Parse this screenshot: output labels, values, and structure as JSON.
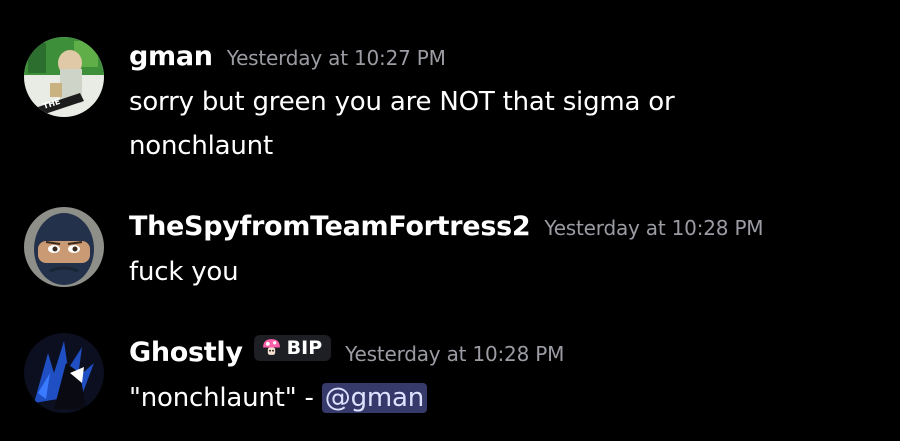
{
  "messages": [
    {
      "username": "gman",
      "timestamp": "Yesterday at 10:27 PM",
      "lines": [
        "sorry but green you are NOT that sigma or",
        "nonchlaunt"
      ]
    },
    {
      "username": "TheSpyfromTeamFortress2",
      "timestamp": "Yesterday at 10:28 PM",
      "lines": [
        "fuck you"
      ]
    },
    {
      "username": "Ghostly",
      "tag": {
        "icon": "mushroom-icon",
        "label": "BIP"
      },
      "timestamp": "Yesterday at 10:28 PM",
      "text": "\"nonchlaunt\" - ",
      "mention": "@gman"
    }
  ],
  "colors": {
    "background": "#000000",
    "timestamp": "#9b9ca3",
    "mention_bg": "#363a6b",
    "tag_bg": "#1e1f24"
  }
}
